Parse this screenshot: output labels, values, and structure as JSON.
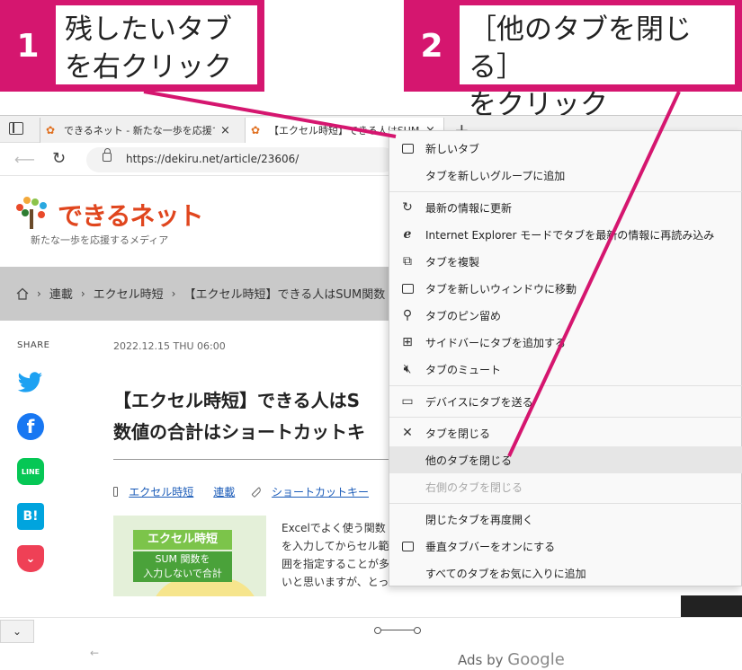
{
  "callouts": [
    {
      "number": "1",
      "line1": "残したいタブ",
      "line2": "を右クリック"
    },
    {
      "number": "2",
      "line1": "［他のタブを閉じる］",
      "line2": "をクリック"
    }
  ],
  "tabs": [
    {
      "title": "できるネット - 新たな一歩を応援するメディア",
      "close": "×"
    },
    {
      "title": "【エクセル時短】できる人はSUM関数",
      "close": "×"
    }
  ],
  "new_tab_label": "+",
  "address": {
    "url": "https://dekiru.net/article/23606/"
  },
  "logo": {
    "name": "できるネット",
    "tagline": "新たな一歩を応援するメディア"
  },
  "breadcrumb": [
    "連載",
    "エクセル時短",
    "【エクセル時短】できる人はSUM関数"
  ],
  "share_label": "SHARE",
  "article": {
    "date": "2022.12.15 THU 06:00",
    "headline_line1": "【エクセル時短】できる人はS",
    "headline_line2": "数値の合計はショートカットキ",
    "category_links": [
      "エクセル時短",
      "連載"
    ],
    "tag_link": "ショートカットキー",
    "thumb_line1": "エクセル時短",
    "thumb_line2": "SUM 関数を",
    "thumb_line3": "入力しないで合計",
    "excerpt": "Excelでよく使う関数を入力してからセル範囲を指定することが多いと思いますが、とっておきのショー"
  },
  "ads_label": "Ads by",
  "ads_brand": "Google",
  "context_menu": [
    {
      "label": "新しいタブ",
      "icon": "new-tab-icon",
      "state": "normal"
    },
    {
      "label": "タブを新しいグループに追加",
      "icon": "",
      "state": "normal"
    },
    {
      "label": "最新の情報に更新",
      "icon": "refresh-icon",
      "state": "normal"
    },
    {
      "label": "Internet Explorer モードでタブを最新の情報に再読み込み",
      "icon": "ie-icon",
      "state": "normal"
    },
    {
      "label": "タブを複製",
      "icon": "duplicate-icon",
      "state": "normal"
    },
    {
      "label": "タブを新しいウィンドウに移動",
      "icon": "window-icon",
      "state": "normal"
    },
    {
      "label": "タブのピン留め",
      "icon": "pin-icon",
      "state": "normal"
    },
    {
      "label": "サイドバーにタブを追加する",
      "icon": "sidebar-add-icon",
      "state": "normal"
    },
    {
      "label": "タブのミュート",
      "icon": "mute-icon",
      "state": "normal"
    },
    {
      "label": "デバイスにタブを送る",
      "icon": "device-icon",
      "state": "normal"
    },
    {
      "label": "タブを閉じる",
      "icon": "close-icon",
      "state": "normal"
    },
    {
      "label": "他のタブを閉じる",
      "icon": "",
      "state": "highlighted"
    },
    {
      "label": "右側のタブを閉じる",
      "icon": "",
      "state": "disabled"
    },
    {
      "label": "閉じたタブを再度開く",
      "icon": "",
      "state": "normal"
    },
    {
      "label": "垂直タブバーをオンにする",
      "icon": "vertical-tabs-icon",
      "state": "normal"
    },
    {
      "label": "すべてのタブをお気に入りに追加",
      "icon": "",
      "state": "normal"
    }
  ],
  "colors": {
    "accent": "#d5166f",
    "logo": "#e0461e",
    "link": "#1a5bb8"
  }
}
